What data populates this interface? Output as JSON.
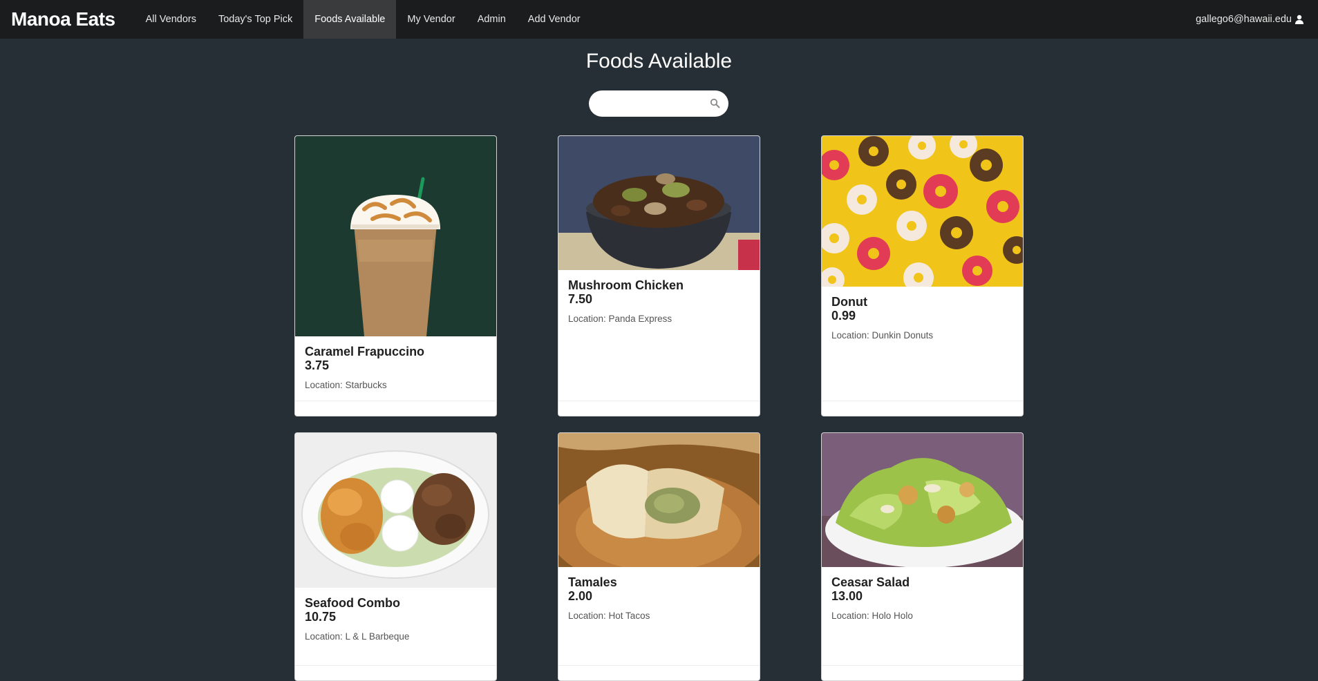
{
  "nav": {
    "brand": "Manoa Eats",
    "items": [
      {
        "label": "All Vendors"
      },
      {
        "label": "Today's Top Pick"
      },
      {
        "label": "Foods Available"
      },
      {
        "label": "My Vendor"
      },
      {
        "label": "Admin"
      },
      {
        "label": "Add Vendor"
      }
    ],
    "active": "Foods Available",
    "user": "gallego6@hawaii.edu",
    "user_icon": "user-icon"
  },
  "page": {
    "title": "Foods Available",
    "search_placeholder": "",
    "search_icon": "search-icon"
  },
  "foods": [
    {
      "name": "Caramel Frapuccino",
      "price": "3.75",
      "location": "Location: Starbucks"
    },
    {
      "name": "Mushroom Chicken",
      "price": "7.50",
      "location": "Location: Panda Express"
    },
    {
      "name": "Donut",
      "price": "0.99",
      "location": "Location: Dunkin Donuts"
    },
    {
      "name": "Seafood Combo",
      "price": "10.75",
      "location": "Location: L & L Barbeque"
    },
    {
      "name": "Tamales",
      "price": "2.00",
      "location": "Location: Hot Tacos"
    },
    {
      "name": "Ceasar Salad",
      "price": "13.00",
      "location": "Location: Holo Holo"
    }
  ],
  "colors": {
    "background": "#262f35",
    "navbar": "#1b1c1d",
    "active_tab": "#3a3b3c"
  }
}
